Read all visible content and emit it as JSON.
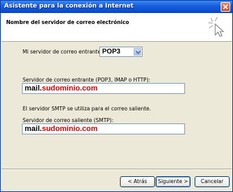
{
  "window": {
    "title": "Asistente para la conexión a Internet"
  },
  "header": {
    "title": "Nombre del servidor de correo electrónico"
  },
  "incoming_type": {
    "label": "Mi servidor de correo entrante es",
    "selected": "POP3"
  },
  "incoming_server": {
    "label": "Servidor de correo entrante (POP3, IMAP o HTTP):",
    "value_prefix": "mail.",
    "value_domain": "sudominio.com"
  },
  "smtp_note": "El servidor SMTP se utiliza para el correo saliente.",
  "outgoing_server": {
    "label": "Servidor de correo saliente (SMTP):",
    "value_prefix": "mail.",
    "value_domain": "sudominio.com"
  },
  "buttons": {
    "back": "< Atrás",
    "next": "Siguiente >",
    "cancel": "Cancelar"
  },
  "colors": {
    "title_bar": "#0b4fd4",
    "domain_text": "#e00000"
  }
}
